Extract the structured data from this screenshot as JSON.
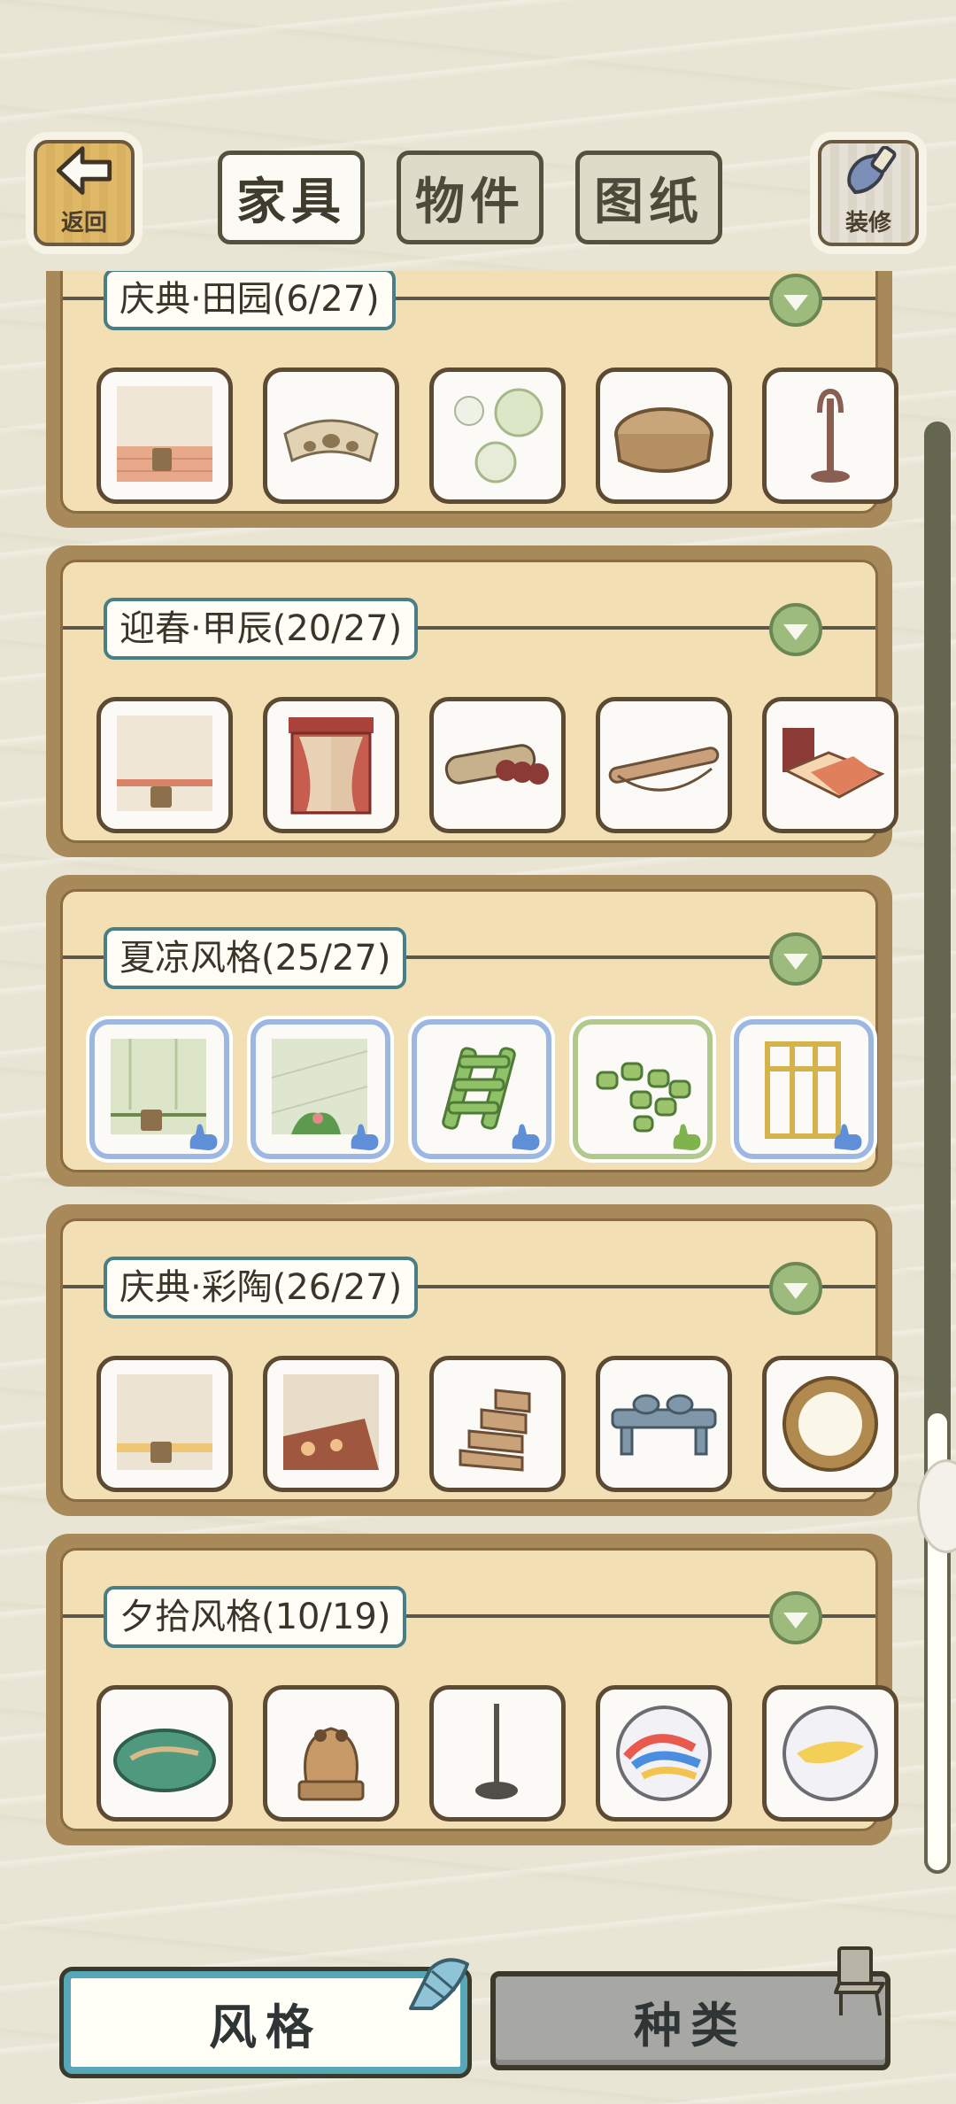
{
  "topbar": {
    "back_label": "返回",
    "decorate_label": "装修",
    "tabs": [
      {
        "label": "家具",
        "active": true
      },
      {
        "label": "物件",
        "active": false
      },
      {
        "label": "图纸",
        "active": false
      }
    ]
  },
  "sections": [
    {
      "title": "庆典·田园(6/27)",
      "items": [
        "wallpaper-brick",
        "wooden-boat-bench",
        "round-plates",
        "wicker-basket",
        "coat-stand"
      ]
    },
    {
      "title": "迎春·甲辰(20/27)",
      "items": [
        "wallpaper-brick",
        "red-doorway",
        "rolled-scrolls",
        "scroll-bow",
        "red-bed"
      ]
    },
    {
      "title": "夏凉风格(25/27)",
      "items": [
        "bamboo-wallpaper",
        "green-floor-plant",
        "bamboo-ladder",
        "bamboo-stools",
        "bamboo-screen"
      ],
      "highlight": [
        "blue",
        "blue",
        "blue",
        "green",
        "blue"
      ]
    },
    {
      "title": "庆典·彩陶(26/27)",
      "items": [
        "wallpaper-plain",
        "floral-rug",
        "clay-steps",
        "blue-pottery-stand",
        "round-mirror"
      ]
    },
    {
      "title": "夕拾风格(10/19)",
      "items": [
        "green-stone",
        "frog-statue",
        "pole-stand",
        "marble-blue",
        "marble-yellow"
      ]
    }
  ],
  "bottom": {
    "style_label": "风格",
    "type_label": "种类"
  },
  "colors": {
    "background": "#e9e5d4",
    "panel": "#f3dfb4",
    "frame": "#a88a5a",
    "title_border": "#4a7e86",
    "toggle": "#9dbb7c",
    "highlight_blue": "#9db7e3",
    "highlight_green": "#b2c98d",
    "scrollbar": "#65664f",
    "active_tab_border": "#58a7b8"
  }
}
